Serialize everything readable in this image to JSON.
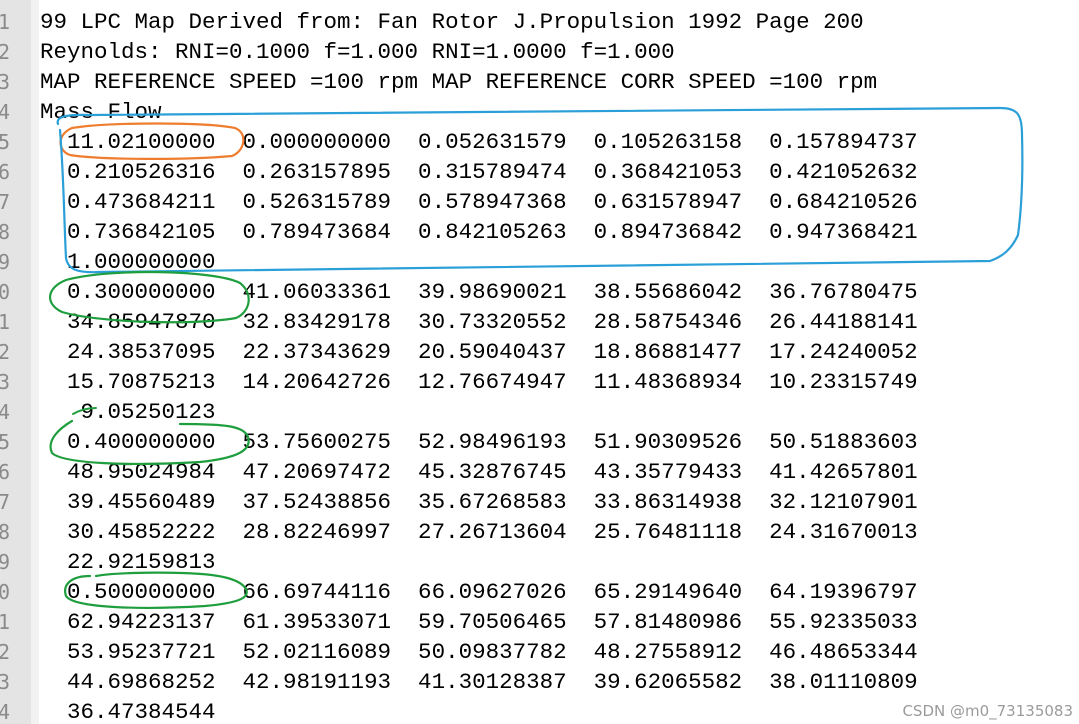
{
  "editor": {
    "line_numbers": [
      "1",
      "2",
      "3",
      "4",
      "5",
      "6",
      "7",
      "8",
      "9",
      "0",
      "1",
      "2",
      "3",
      "4",
      "5",
      "6",
      "7",
      "8",
      "9",
      "0",
      "1",
      "2",
      "3",
      "4"
    ],
    "lines": [
      "99 LPC Map Derived from: Fan Rotor J.Propulsion 1992 Page 200",
      "Reynolds: RNI=0.1000 f=1.000 RNI=1.0000 f=1.000",
      "MAP REFERENCE SPEED =100 rpm MAP REFERENCE CORR SPEED =100 rpm",
      "Mass Flow",
      "  11.02100000  0.000000000  0.052631579  0.105263158  0.157894737",
      "  0.210526316  0.263157895  0.315789474  0.368421053  0.421052632",
      "  0.473684211  0.526315789  0.578947368  0.631578947  0.684210526",
      "  0.736842105  0.789473684  0.842105263  0.894736842  0.947368421",
      "  1.000000000",
      "  0.300000000  41.06033361  39.98690021  38.55686042  36.76780475",
      "  34.85947870  32.83429178  30.73320552  28.58754346  26.44188141",
      "  24.38537095  22.37343629  20.59040437  18.86881477  17.24240052",
      "  15.70875213  14.20642726  12.76674947  11.48368934  10.23315749",
      "   9.05250123",
      "  0.400000000  53.75600275  52.98496193  51.90309526  50.51883603",
      "  48.95024984  47.20697472  45.32876745  43.35779433  41.42657801",
      "  39.45560489  37.52438856  35.67268583  33.86314938  32.12107901",
      "  30.45852222  28.82246997  27.26713604  25.76481118  24.31670013",
      "  22.92159813",
      "  0.500000000  66.69744116  66.09627026  65.29149640  64.19396797",
      "  62.94223137  61.39533071  59.70506465  57.81480986  55.92335033",
      "  53.95237721  52.02116089  50.09837782  48.27558912  46.48653344",
      "  44.69868252  42.98191193  41.30128387  39.62065582  38.01110809",
      "  36.47384544"
    ]
  },
  "annotations": {
    "colors": {
      "orange": "#ef7d2f",
      "blue": "#2a9fd8",
      "green": "#1f9e3e"
    }
  },
  "watermark": {
    "text": "CSDN @m0_73135083"
  }
}
